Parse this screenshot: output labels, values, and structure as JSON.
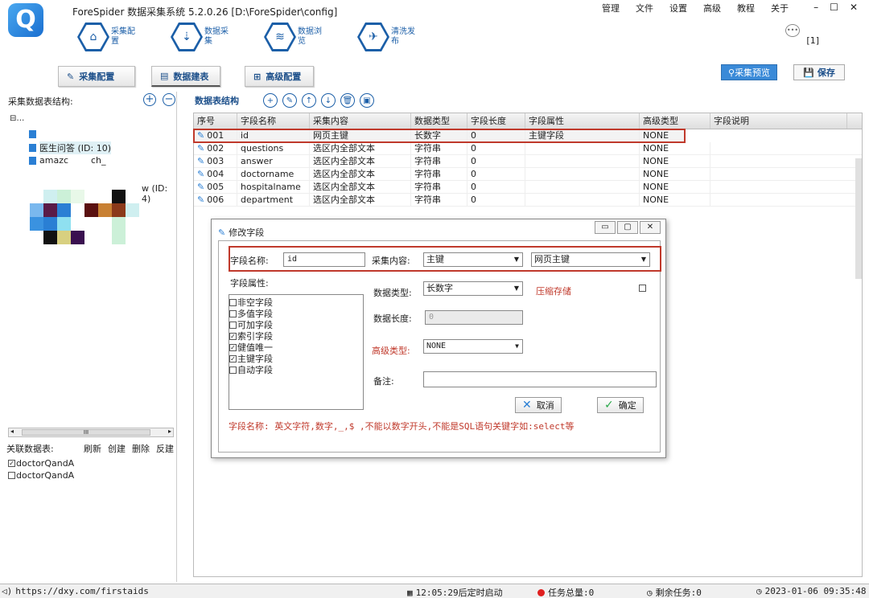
{
  "app": {
    "title": "ForeSpider 数据采集系统  5.2.0.26  [D:\\ForeSpider\\config]",
    "logo_letter": "Q",
    "menu": [
      "管理",
      "文件",
      "设置",
      "高级",
      "教程",
      "关于"
    ],
    "window_controls": [
      "–",
      "☐",
      "✕"
    ],
    "notification_count": "[1]"
  },
  "main_nav": [
    {
      "icon": "⌂",
      "label": "采集配置"
    },
    {
      "icon": "⇣",
      "label": "数据采集"
    },
    {
      "icon": "≋",
      "label": "数据浏览"
    },
    {
      "icon": "✈",
      "label": "清洗发布"
    }
  ],
  "sub_tabs": [
    {
      "icon": "✎",
      "label": "采集配置"
    },
    {
      "icon": "▤",
      "label": "数据建表"
    },
    {
      "icon": "⊞",
      "label": "高级配置"
    }
  ],
  "toolbar_right": {
    "preview_label": "采集预览",
    "save_label": "保存"
  },
  "left_panel": {
    "header": "采集数据表结构:",
    "tree_root": "⊟…",
    "tree_nodes": [
      "医生问答 (ID: 10)",
      "amazc        ch_",
      "w (ID: 4)"
    ],
    "hscroll_label": "III",
    "related_header": "关联数据表:",
    "related_actions": [
      "刷新",
      "创建",
      "删除",
      "反建"
    ],
    "related_items": [
      {
        "label": "doctorQandA",
        "checked": true
      },
      {
        "label": "doctorQandA",
        "checked": false
      }
    ]
  },
  "table": {
    "title": "数据表结构",
    "tool_icons": [
      "+",
      "✎",
      "↑",
      "↓",
      "🗑",
      "▣"
    ],
    "columns": [
      "序号",
      "字段名称",
      "采集内容",
      "数据类型",
      "字段长度",
      "字段属性",
      "高级类型",
      "字段说明"
    ],
    "rows": [
      [
        "001",
        "id",
        "网页主键",
        "长数字",
        "0",
        "主键字段",
        "NONE",
        ""
      ],
      [
        "002",
        "questions",
        "选区内全部文本",
        "字符串",
        "0",
        "",
        "NONE",
        ""
      ],
      [
        "003",
        "answer",
        "选区内全部文本",
        "字符串",
        "0",
        "",
        "NONE",
        ""
      ],
      [
        "004",
        "doctorname",
        "选区内全部文本",
        "字符串",
        "0",
        "",
        "NONE",
        ""
      ],
      [
        "005",
        "hospitalname",
        "选区内全部文本",
        "字符串",
        "0",
        "",
        "NONE",
        ""
      ],
      [
        "006",
        "department",
        "选区内全部文本",
        "字符串",
        "0",
        "",
        "NONE",
        ""
      ]
    ]
  },
  "dialog": {
    "title": "修改字段",
    "field_name_label": "字段名称:",
    "field_name_value": "id",
    "content_label": "采集内容:",
    "content_value": "主键",
    "content_sub_value": "网页主键",
    "attr_label": "字段属性:",
    "attributes": [
      {
        "label": "非空字段",
        "checked": false
      },
      {
        "label": "多值字段",
        "checked": false
      },
      {
        "label": "可加字段",
        "checked": false
      },
      {
        "label": "索引字段",
        "checked": true
      },
      {
        "label": "健值唯一",
        "checked": true
      },
      {
        "label": "主键字段",
        "checked": true
      },
      {
        "label": "自动字段",
        "checked": false
      }
    ],
    "data_type_label": "数据类型:",
    "data_type_value": "长数字",
    "compress_label": "压缩存储",
    "data_length_label": "数据长度:",
    "data_length_value": "0",
    "adv_type_label": "高级类型:",
    "adv_type_value": "NONE",
    "remark_label": "备注:",
    "remark_value": "",
    "cancel_label": "取消",
    "ok_label": "确定",
    "hint": "字段名称: 英文字符,数字,_,$ ,不能以数字开头,不能是SQL语句关键字如:select等"
  },
  "status": {
    "url": "https://dxy.com/firstaids",
    "scheduler": "12:05:29后定时启动",
    "task_total": "任务总量:0",
    "remaining": "剩余任务:0",
    "datetime": "2023-01-06 09:35:48"
  },
  "colors": {
    "brand": "#1c5fa8",
    "highlight": "#c0392b",
    "preview": "#3a8ad8"
  }
}
